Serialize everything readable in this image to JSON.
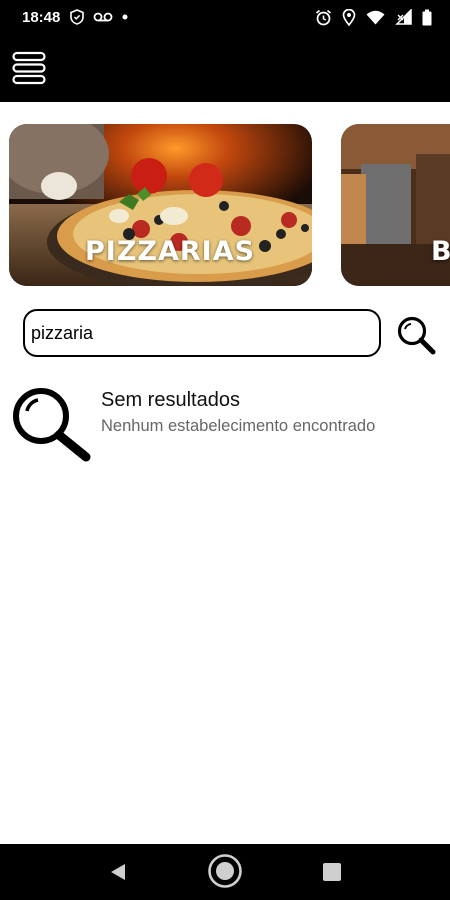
{
  "status_bar": {
    "time": "18:48",
    "left_icons": [
      "shield-icon",
      "voicemail-icon",
      "dot-icon"
    ],
    "right_icons": [
      "alarm-icon",
      "location-icon",
      "wifi-icon",
      "signal-icon",
      "battery-icon"
    ]
  },
  "header": {
    "menu_icon": "hamburger-menu-icon",
    "background": "#000000"
  },
  "categories": [
    {
      "label": "PIZZARIAS"
    },
    {
      "label": "B"
    }
  ],
  "search": {
    "value": "pizzaria",
    "button_icon": "search-icon"
  },
  "empty_state": {
    "icon": "magnifier-icon",
    "title": "Sem resultados",
    "subtitle": "Nenhum estabelecimento encontrado"
  },
  "nav_bar": {
    "icons": [
      "back-icon",
      "home-icon",
      "recents-icon"
    ]
  }
}
